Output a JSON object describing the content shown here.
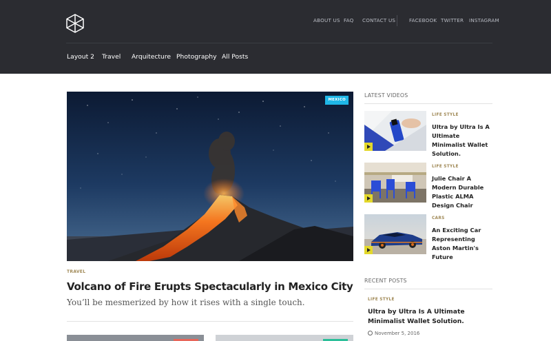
{
  "header": {
    "top_links": [
      "ABOUT US",
      "FAQ",
      "CONTACT US"
    ],
    "social_links": [
      "FACEBOOK",
      "TWITTER",
      "INSTAGRAM"
    ],
    "main_nav": [
      "Layout 2",
      "Travel",
      "Arquitecture",
      "Photography",
      "All Posts"
    ]
  },
  "hero": {
    "tag": "MEXICO",
    "category": "TRAVEL",
    "title": "Volcano of Fire Erupts Spectacularly in Mexico City",
    "subtitle": "You’ll be mesmerized by how it rises with a single touch."
  },
  "sidebar": {
    "videos_heading": "LATEST VIDEOS",
    "videos": [
      {
        "category": "LIFE STYLE",
        "title": "Ultra by Ultra Is A Ultimate Minimalist Wallet Solution."
      },
      {
        "category": "LIFE STYLE",
        "title": "Julie Chair A Modern Durable Plastic ALMA Design Chair"
      },
      {
        "category": "CARS",
        "title": "An Exciting Car Representing Aston Martin's Future"
      }
    ],
    "recent_heading": "RECENT POSTS",
    "recent": {
      "category": "LIFE STYLE",
      "title": "Ultra by Ultra Is A Ultimate Minimalist Wallet Solution.",
      "date": "November 5, 2016"
    }
  },
  "colors": {
    "header_bg": "#2b2c31",
    "category_gold": "#a08956",
    "tag_blue": "#1fb7e7",
    "play_yellow": "#e3d82b"
  }
}
